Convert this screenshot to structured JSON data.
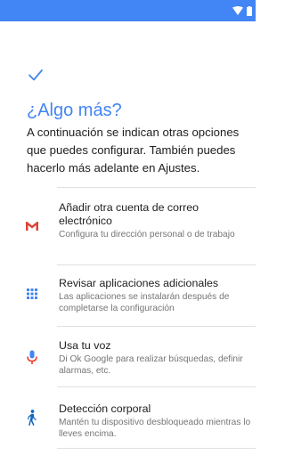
{
  "colors": {
    "accent": "#4285f4",
    "gmail_red": "#db4437",
    "apps_blue": "#4285f4",
    "voice_blue": "#4285f4",
    "voice_red": "#ea4335",
    "fit_blue": "#1565c0"
  },
  "status_bar": {
    "icons": [
      "wifi-icon",
      "battery-icon"
    ]
  },
  "header": {
    "icon": "check-icon",
    "title": "¿Algo más?",
    "description": "A continuación se indican otras opciones que puedes configurar. También puedes hacerlo más adelante en Ajustes."
  },
  "options": [
    {
      "icon": "gmail-icon",
      "title": "Añadir otra cuenta de correo electrónico",
      "subtitle": "Configura tu dirección personal o de trabajo"
    },
    {
      "icon": "apps-grid-icon",
      "title": "Revisar aplicaciones adicionales",
      "subtitle": "Las aplicaciones se instalarán después de completarse la configuración"
    },
    {
      "icon": "microphone-icon",
      "title": "Usa tu voz",
      "subtitle": "Di Ok Google para realizar búsquedas, definir alarmas, etc."
    },
    {
      "icon": "walking-person-icon",
      "title": "Detección corporal",
      "subtitle": "Mantén tu dispositivo desbloqueado mientras lo lleves encima."
    }
  ]
}
